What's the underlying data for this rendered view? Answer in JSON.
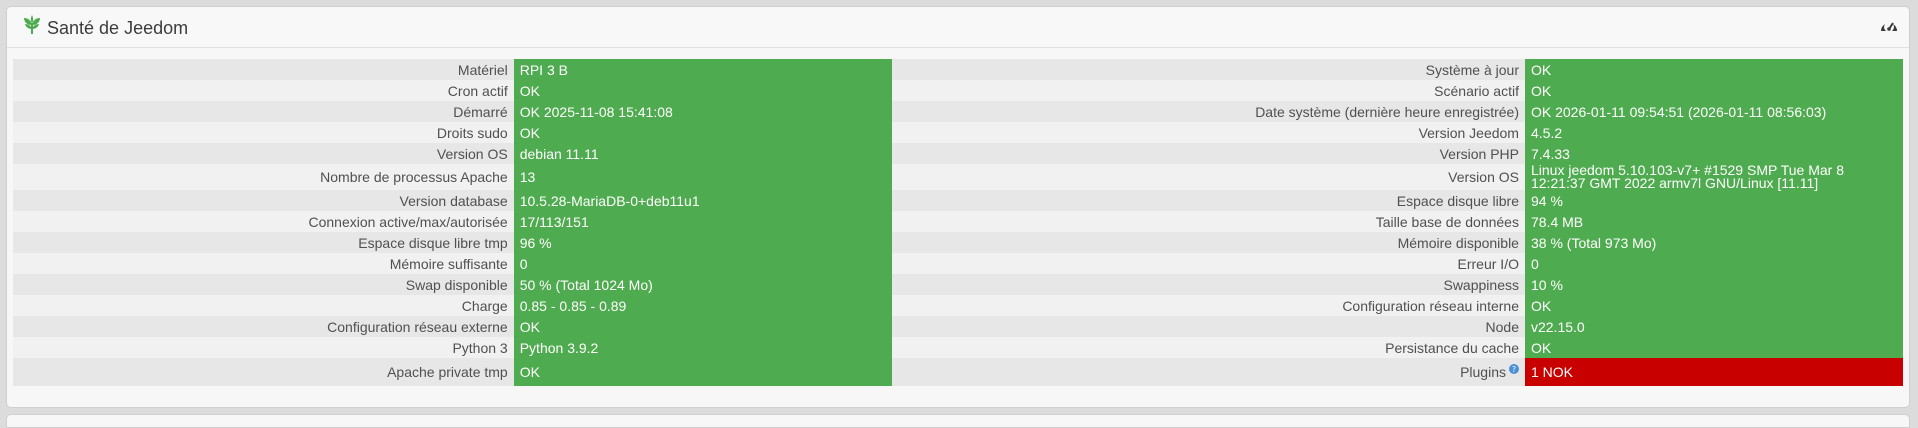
{
  "header": {
    "title": "Santé de Jeedom",
    "logo_icon": "jeedom-leaf-icon",
    "gauge_icon": "tachometer-icon"
  },
  "colors": {
    "ok": "#4fab4f",
    "nok": "#c90000",
    "help": "#4a90d9"
  },
  "rows": [
    {
      "left_label": "Matériel",
      "left_value": "RPI 3 B",
      "right_label": "Système à jour",
      "right_value": "OK"
    },
    {
      "left_label": "Cron actif",
      "left_value": "OK",
      "right_label": "Scénario actif",
      "right_value": "OK"
    },
    {
      "left_label": "Démarré",
      "left_value": "OK 2025-11-08 15:41:08",
      "right_label": "Date système (dernière heure enregistrée)",
      "right_value": "OK 2026-01-11 09:54:51 (2026-01-11 08:56:03)"
    },
    {
      "left_label": "Droits sudo",
      "left_value": "OK",
      "right_label": "Version Jeedom",
      "right_value": "4.5.2"
    },
    {
      "left_label": "Version OS",
      "left_value": "debian 11.11",
      "right_label": "Version PHP",
      "right_value": "7.4.33"
    },
    {
      "left_label": "Nombre de processus Apache",
      "left_value": "13",
      "right_label": "Version OS",
      "right_value": "Linux jeedom 5.10.103-v7+ #1529 SMP Tue Mar 8 12:21:37 GMT 2022 armv7l GNU/Linux [11.11]"
    },
    {
      "left_label": "Version database",
      "left_value": "10.5.28-MariaDB-0+deb11u1",
      "right_label": "Espace disque libre",
      "right_value": "94 %"
    },
    {
      "left_label": "Connexion active/max/autorisée",
      "left_value": "17/113/151",
      "right_label": "Taille base de données",
      "right_value": "78.4 MB"
    },
    {
      "left_label": "Espace disque libre tmp",
      "left_value": "96 %",
      "right_label": "Mémoire disponible",
      "right_value": "38 % (Total 973 Mo)"
    },
    {
      "left_label": "Mémoire suffisante",
      "left_value": "0",
      "right_label": "Erreur I/O",
      "right_value": "0"
    },
    {
      "left_label": "Swap disponible",
      "left_value": "50 % (Total 1024 Mo)",
      "right_label": "Swappiness",
      "right_value": "10 %"
    },
    {
      "left_label": "Charge",
      "left_value": "0.85 - 0.85 - 0.89",
      "right_label": "Configuration réseau interne",
      "right_value": "OK"
    },
    {
      "left_label": "Configuration réseau externe",
      "left_value": "OK",
      "right_label": "Node",
      "right_value": "v22.15.0"
    },
    {
      "left_label": "Python 3",
      "left_value": "Python 3.9.2",
      "right_label": "Persistance du cache",
      "right_value": "OK"
    },
    {
      "left_label": "Apache private tmp",
      "left_value": "OK",
      "right_label": "Plugins",
      "right_value": "1 NOK"
    }
  ]
}
